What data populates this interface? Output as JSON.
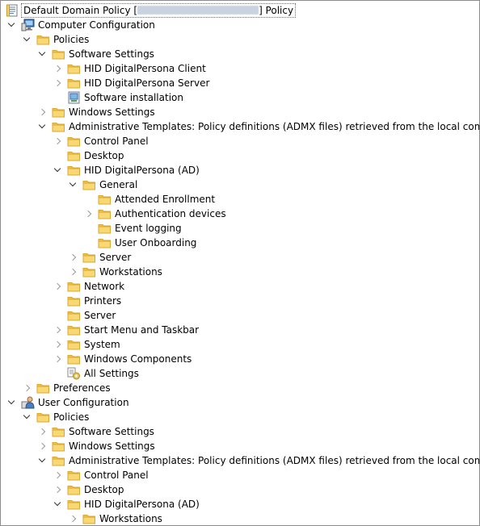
{
  "root": {
    "title_prefix": "Default Domain Policy [",
    "title_suffix": "] Policy"
  },
  "tree": {
    "computer_configuration": "Computer Configuration",
    "cc_policies": "Policies",
    "cc_software_settings": "Software Settings",
    "hid_digitalpersona_client": "HID DigitalPersona Client",
    "hid_digitalpersona_server": "HID DigitalPersona Server",
    "software_installation": "Software installation",
    "cc_windows_settings": "Windows Settings",
    "cc_admin_templates": "Administrative Templates: Policy definitions (ADMX files) retrieved from the local computer.",
    "cc_control_panel": "Control Panel",
    "cc_desktop": "Desktop",
    "cc_hid_dp_ad": "HID DigitalPersona (AD)",
    "general": "General",
    "attended_enrollment": "Attended Enrollment",
    "authentication_devices": "Authentication devices",
    "event_logging": "Event logging",
    "user_onboarding": "User Onboarding",
    "server_sub": "Server",
    "workstations_sub": "Workstations",
    "network": "Network",
    "printers": "Printers",
    "server": "Server",
    "start_menu_taskbar": "Start Menu and Taskbar",
    "system": "System",
    "windows_components": "Windows Components",
    "all_settings": "All Settings",
    "preferences": "Preferences",
    "user_configuration": "User Configuration",
    "uc_policies": "Policies",
    "uc_software_settings": "Software Settings",
    "uc_windows_settings": "Windows Settings",
    "uc_admin_templates": "Administrative Templates: Policy definitions (ADMX files) retrieved from the local computer.",
    "uc_control_panel": "Control Panel",
    "uc_desktop": "Desktop",
    "uc_hid_dp_ad": "HID DigitalPersona (AD)",
    "uc_workstations": "Workstations"
  },
  "colors": {
    "folder_fill": "#f8d775",
    "folder_edge": "#d9a931",
    "frame_border": "#8c8c8c"
  }
}
